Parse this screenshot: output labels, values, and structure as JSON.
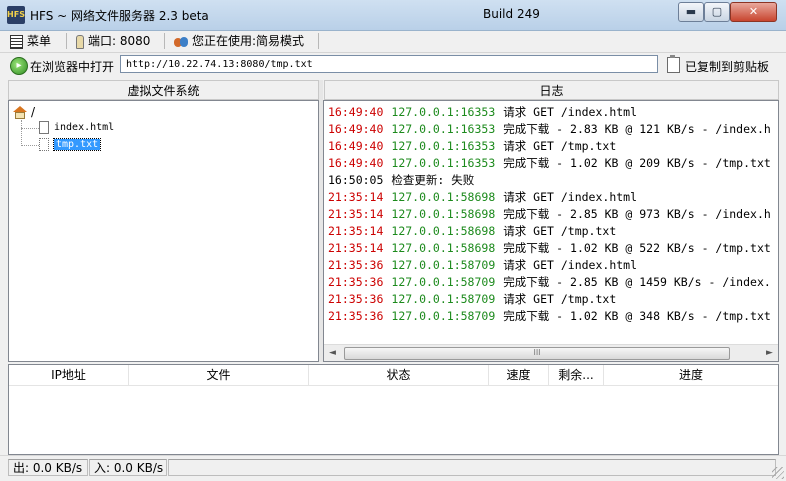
{
  "window": {
    "title": "HFS ~ 网络文件服务器 2.3 beta",
    "build": "Build 249",
    "app_icon": "HFS",
    "controls": {
      "minimize": "▬",
      "maximize": "▢",
      "close": "✕"
    }
  },
  "toolbar": {
    "menu_label": "菜单",
    "port_label": "端口: 8080",
    "mode_label": "您正在使用:简易模式"
  },
  "urlbar": {
    "open_browser_label": "在浏览器中打开",
    "url": "http://10.22.74.13:8080/tmp.txt",
    "copied_label": "已复制到剪贴板"
  },
  "vfs": {
    "title": "虚拟文件系统",
    "root": "/",
    "files": [
      "index.html",
      "tmp.txt"
    ],
    "selected": "tmp.txt"
  },
  "log": {
    "title": "日志",
    "colors": {
      "time": "#cc0000",
      "ip": "#1c8a1c",
      "message": "#000000"
    },
    "lines": [
      {
        "time": "16:49:40",
        "ip": "127.0.0.1:16353",
        "msg": "请求 GET /index.html"
      },
      {
        "time": "16:49:40",
        "ip": "127.0.0.1:16353",
        "msg": "完成下载 - 2.83 KB @ 121 KB/s - /index.h"
      },
      {
        "time": "16:49:40",
        "ip": "127.0.0.1:16353",
        "msg": "请求 GET /tmp.txt"
      },
      {
        "time": "16:49:40",
        "ip": "127.0.0.1:16353",
        "msg": "完成下载 - 1.02 KB @ 209 KB/s - /tmp.txt"
      },
      {
        "time": "16:50:05",
        "ip": "",
        "msg": "检查更新: 失败",
        "time_color": "#000000"
      },
      {
        "time": "21:35:14",
        "ip": "127.0.0.1:58698",
        "msg": "请求 GET /index.html"
      },
      {
        "time": "21:35:14",
        "ip": "127.0.0.1:58698",
        "msg": "完成下载 - 2.85 KB @ 973 KB/s - /index.h"
      },
      {
        "time": "21:35:14",
        "ip": "127.0.0.1:58698",
        "msg": "请求 GET /tmp.txt"
      },
      {
        "time": "21:35:14",
        "ip": "127.0.0.1:58698",
        "msg": "完成下载 - 1.02 KB @ 522 KB/s - /tmp.txt"
      },
      {
        "time": "21:35:36",
        "ip": "127.0.0.1:58709",
        "msg": "请求 GET /index.html"
      },
      {
        "time": "21:35:36",
        "ip": "127.0.0.1:58709",
        "msg": "完成下载 - 2.85 KB @ 1459 KB/s - /index."
      },
      {
        "time": "21:35:36",
        "ip": "127.0.0.1:58709",
        "msg": "请求 GET /tmp.txt"
      },
      {
        "time": "21:35:36",
        "ip": "127.0.0.1:58709",
        "msg": "完成下载 - 1.02 KB @ 348 KB/s - /tmp.txt"
      }
    ],
    "scrollbar": {
      "thumb_label": "III",
      "left_arrow": "◄",
      "right_arrow": "►"
    }
  },
  "connections": {
    "columns": [
      "IP地址",
      "文件",
      "状态",
      "速度",
      "剩余...",
      "进度"
    ],
    "rows": []
  },
  "statusbar": {
    "out_label": "出: 0.0 KB/s",
    "in_label": "入: 0.0 KB/s"
  }
}
